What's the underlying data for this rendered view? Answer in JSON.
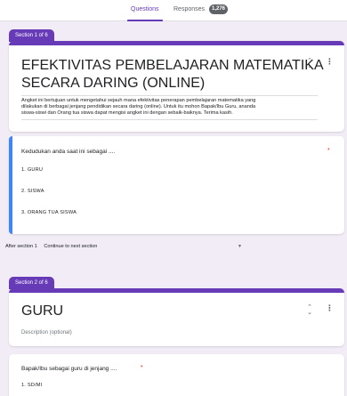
{
  "tabs": {
    "questions": "Questions",
    "responses": "Responses",
    "responses_count": "1,276"
  },
  "section1": {
    "tag": "Section 1 of 6",
    "title_line1": "EFEKTIVITAS PEMBELAJARAN MATEMATIKA",
    "title_line2": "SECARA DARING (ONLINE)",
    "desc_line1": "Angket ini bertujuan untuk mengetahui sejauh mana efektivitas  penerapan pembelajaran matematika yang",
    "desc_line2": "dilakukan di berbagai jenjang pendidikan secara daring (online). Untuk itu mohon Bapak/Ibu Guru,  ananda",
    "desc_line3": "siswa-siswi dan Orang tua siswa dapat mengisi angket ini dengan sebaik-baiknya. Terima kasih."
  },
  "question1": {
    "text": "Kedudukan anda saat ini sebagai ....",
    "required_mark": "*",
    "options": [
      "1.  GURU",
      "2.  SISWA",
      "3.  ORANG TUA SISWA"
    ]
  },
  "after_section": {
    "label": "After section 1",
    "value": "Continue to next section",
    "arrow": "▼"
  },
  "section2": {
    "tag": "Section 2 of 6",
    "title": "GURU",
    "description_placeholder": "Description (optional)"
  },
  "question2": {
    "text": "Bapak/Ibu sebagai guru di jenjang .... ",
    "required_mark": "*",
    "options": [
      "1.  SD/MI"
    ]
  },
  "icons": {
    "collapse": "⌃\n⌄",
    "more": "⋮"
  },
  "colors": {
    "accent": "#673ab7",
    "background": "#f1ecf6",
    "focus": "#4285f4",
    "required": "#d93025"
  }
}
